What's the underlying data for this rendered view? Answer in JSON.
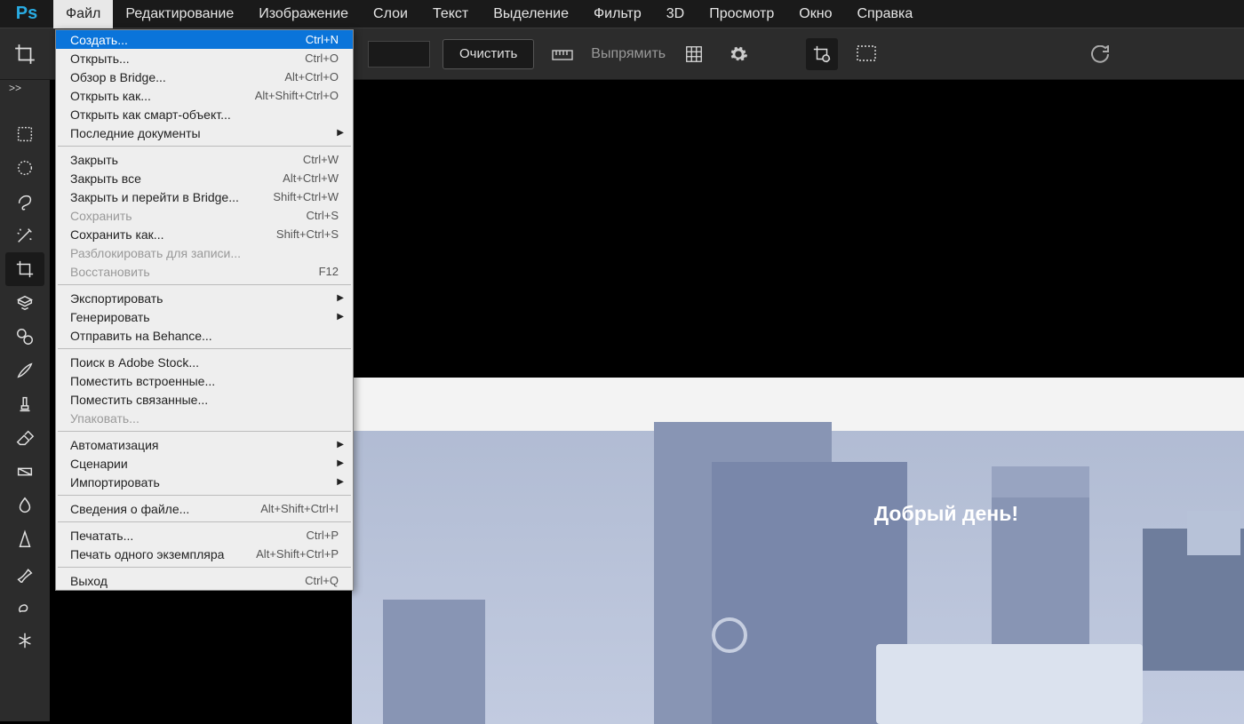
{
  "app_logo": "Ps",
  "menubar": [
    "Файл",
    "Редактирование",
    "Изображение",
    "Слои",
    "Текст",
    "Выделение",
    "Фильтр",
    "3D",
    "Просмотр",
    "Окно",
    "Справка"
  ],
  "active_menu_index": 0,
  "options": {
    "clear_btn": "Очистить",
    "straighten_label": "Выпрямить"
  },
  "dropdown": {
    "groups": [
      [
        {
          "label": "Создать...",
          "shortcut": "Ctrl+N",
          "highlight": true
        },
        {
          "label": "Открыть...",
          "shortcut": "Ctrl+O"
        },
        {
          "label": "Обзор в Bridge...",
          "shortcut": "Alt+Ctrl+O"
        },
        {
          "label": "Открыть как...",
          "shortcut": "Alt+Shift+Ctrl+O"
        },
        {
          "label": "Открыть как смарт-объект..."
        },
        {
          "label": "Последние документы",
          "submenu": true
        }
      ],
      [
        {
          "label": "Закрыть",
          "shortcut": "Ctrl+W"
        },
        {
          "label": "Закрыть все",
          "shortcut": "Alt+Ctrl+W"
        },
        {
          "label": "Закрыть и перейти в Bridge...",
          "shortcut": "Shift+Ctrl+W"
        },
        {
          "label": "Сохранить",
          "shortcut": "Ctrl+S",
          "disabled": true
        },
        {
          "label": "Сохранить как...",
          "shortcut": "Shift+Ctrl+S"
        },
        {
          "label": "Разблокировать для записи...",
          "disabled": true
        },
        {
          "label": "Восстановить",
          "shortcut": "F12",
          "disabled": true
        }
      ],
      [
        {
          "label": "Экспортировать",
          "submenu": true
        },
        {
          "label": "Генерировать",
          "submenu": true
        },
        {
          "label": "Отправить на Behance..."
        }
      ],
      [
        {
          "label": "Поиск в Adobe Stock..."
        },
        {
          "label": "Поместить встроенные..."
        },
        {
          "label": "Поместить связанные..."
        },
        {
          "label": "Упаковать...",
          "disabled": true
        }
      ],
      [
        {
          "label": "Автоматизация",
          "submenu": true
        },
        {
          "label": "Сценарии",
          "submenu": true
        },
        {
          "label": "Импортировать",
          "submenu": true
        }
      ],
      [
        {
          "label": "Сведения о файле...",
          "shortcut": "Alt+Shift+Ctrl+I"
        }
      ],
      [
        {
          "label": "Печатать...",
          "shortcut": "Ctrl+P"
        },
        {
          "label": "Печать одного экземпляра",
          "shortcut": "Alt+Shift+Ctrl+P"
        }
      ],
      [
        {
          "label": "Выход",
          "shortcut": "Ctrl+Q"
        }
      ]
    ]
  },
  "tools": [
    "rect-marquee",
    "ellipse-marquee",
    "lasso",
    "magic-wand",
    "crop",
    "slice",
    "patch",
    "brush",
    "stamp",
    "eraser",
    "gradient",
    "blur",
    "sharpen",
    "pen",
    "smudge",
    "refine"
  ],
  "active_tool_index": 4,
  "document": {
    "greeting": "Добрый день!"
  },
  "expand_indicator": ">>"
}
